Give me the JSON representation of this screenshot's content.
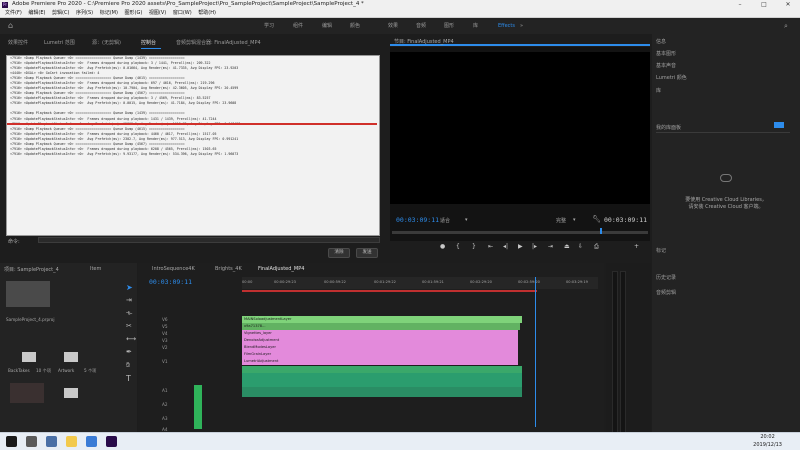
{
  "window": {
    "title": "Adobe Premiere Pro 2020 - C:\\Premiere Pro 2020 assets\\Pro_SampleProject\\Pro_SampleProject\\SampleProject\\SampleProject_4 *",
    "app_icon": "Pr"
  },
  "menubar": [
    "文件(F)",
    "编辑(E)",
    "剪辑(C)",
    "序列(S)",
    "标记(M)",
    "图形(G)",
    "视图(V)",
    "窗口(W)",
    "帮助(H)"
  ],
  "workspaces": [
    {
      "label": "学习",
      "active": false
    },
    {
      "label": "组件",
      "active": false
    },
    {
      "label": "编辑",
      "active": false
    },
    {
      "label": "颜色",
      "active": false
    },
    {
      "label": "效果",
      "active": false
    },
    {
      "label": "音频",
      "active": false
    },
    {
      "label": "图形",
      "active": false
    },
    {
      "label": "库",
      "active": false
    },
    {
      "label": "Effects",
      "active": true
    }
  ],
  "source_tabs": [
    {
      "label": "效果控件",
      "active": false
    },
    {
      "label": "Lumetri 范围",
      "active": false
    },
    {
      "label": "源：(无剪辑)",
      "active": false
    },
    {
      "label": "控制台",
      "active": true
    },
    {
      "label": "音频剪辑混合器: FinalAdjusted_MP4",
      "active": false
    }
  ],
  "console": {
    "lines": [
      "<7916> <Dump Playback Queue> <0> ================== Queue Dump (1439) ==================",
      "<7916> <UpdatePlaybackStatusInfo> <0>  Frames dropped during playback: 3 / 1441, Preroll(ms): 209.322",
      "<7916> <UpdatePlaybackStatusInfo> <0>  Avg Prefetch(ms): 0.01664, Avg Render(ms): 41.7335, Avg Display FPS: 23.9203",
      "<4440> <DXAL> <0> GoCart invocation failed: 4",
      "<7916> <Dump Playback Queue> <0> ================== Queue Dump (4615) ==================",
      "<7916> <UpdatePlaybackStatusInfo> <0>  Frames dropped during playback: 697 / 4616, Preroll(ms): 219.296",
      "<7916> <UpdatePlaybackStatusInfo> <0>  Avg Prefetch(ms): 10.7904, Avg Render(ms): 42.3605, Avg Display FPS: 20.4599",
      "<7916> <Dump Playback Queue> <0> ================== Queue Dump (4567) ==================",
      "<7916> <UpdatePlaybackStatusInfo> <0>  Frames dropped during playback: 3 / 4569, Preroll(ms): 83.5257",
      "<7916> <UpdatePlaybackStatusInfo> <0>  Avg Prefetch(ms): 0.0015, Avg Render(ms): 41.7184, Avg Display FPS: 23.9608",
      "",
      "<7916> <Dump Playback Queue> <0> ================== Queue Dump (1439) ==================",
      "<7916> <UpdatePlaybackStatusInfo> <0>  Frames dropped during playback: 1431 / 1439, Preroll(ms): 41.7244",
      "<7916> <UpdatePlaybackStatusInfo> <0>  Avg Prefetch(ms): 12809.5, Avg Render(ms): 1019.75, Avg Display FPS: 0.647437",
      "<7916> <Dump Playback Queue> <0> ================== Queue Dump (4615) ==================",
      "<7916> <UpdatePlaybackStatusInfo> <0>  Frames dropped during playback: 4460 / 4617, Preroll(ms): 1517.05",
      "<7916> <UpdatePlaybackStatusInfo> <0>  Avg Prefetch(ms): 2302.7, Avg Render(ms): 977.513, Avg Display FPS: 0.991241",
      "<7916> <Dump Playback Queue> <0> ================== Queue Dump (4567) ==================",
      "<7916> <UpdatePlaybackStatusInfo> <0>  Frames dropped during playback: 6208 / 4565, Preroll(ms): 1503.65",
      "<7916> <UpdatePlaybackStatusInfo> <0>  Avg Prefetch(ms): 9.93177, Avg Render(ms): 534.396, Avg Display FPS: 1.96073"
    ],
    "command_label": "命令:",
    "clear_button": "清除",
    "send_button": "发送"
  },
  "program_monitor": {
    "tab_label": "节目: FinalAdjusted_MP4",
    "timecode_current": "00:03:09:11",
    "timecode_duration": "00:03:09:11",
    "fit_label": "适合",
    "quality_label": "完整"
  },
  "right_panel": {
    "items": [
      "信息",
      "基本图形",
      "基本声音",
      "Lumetri 颜色",
      "库"
    ],
    "library_select": "我的库面板",
    "cc_title": "要使用 Creative Cloud Libraries，",
    "cc_subtitle": "请安装 Creative Cloud 客户端。",
    "lower_items": [
      "标记",
      "历史记录",
      "音频剪辑"
    ]
  },
  "project_panel": {
    "tab_label": "项目: SampleProject_4",
    "secondary_tab": "Item",
    "search_label": "SampleProject_4.prproj",
    "items": [
      {
        "label": "BackTakes",
        "count": "10 个项"
      },
      {
        "label": "Artwork",
        "count": "5 个项"
      },
      {
        "label": "",
        "count": ""
      }
    ]
  },
  "timeline": {
    "tabs": [
      {
        "label": "IntroSequence4K",
        "active": false
      },
      {
        "label": "Brights_4K",
        "active": false
      },
      {
        "label": "FinalAdjusted_MP4",
        "active": true
      }
    ],
    "timecode": "00:03:09:11",
    "ruler": [
      "00:00",
      "00:00:29:23",
      "00:00:59:22",
      "00:01:29:22",
      "00:01:59:21",
      "00:02:29:20",
      "00:02:59:20",
      "00:03:29:19"
    ],
    "tracks": [
      "V6",
      "V5",
      "V4",
      "V3",
      "V2",
      "V1",
      "A1",
      "A2",
      "A3",
      "A4"
    ],
    "clips": {
      "v6": "MAINSoloadjustmentLayer",
      "v5": "x9a71378...",
      "v4": "Vignettes_layer",
      "v3": "DenoiseAdjustment",
      "v2": "BlendModesLayer",
      "v1a": "FilmGrainLayer",
      "v1b": "LumetriAdjustment"
    }
  },
  "taskbar": {
    "time": "20:02",
    "date": "2019/12/13"
  }
}
